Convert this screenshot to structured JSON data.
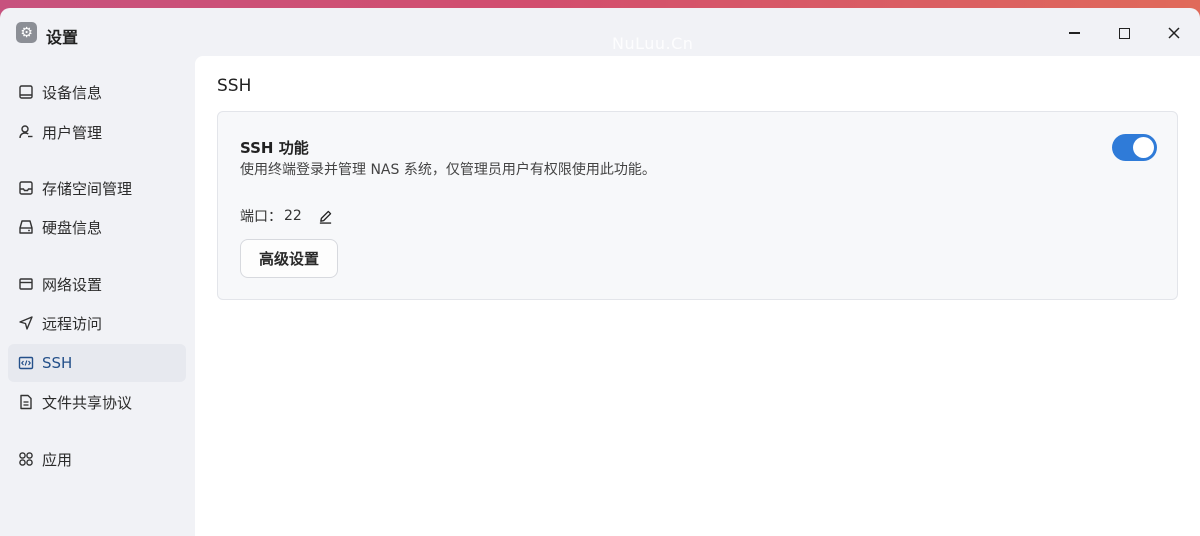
{
  "window": {
    "title": "设置",
    "icon": "gear-icon",
    "watermark": "NuLuu.Cn",
    "controls": [
      "minimize-icon",
      "maximize-icon",
      "close-icon"
    ]
  },
  "sidebar": {
    "items": [
      {
        "label": "设备信息",
        "icon": "device-icon",
        "active": false
      },
      {
        "label": "用户管理",
        "icon": "user-icon",
        "active": false
      },
      {
        "label": "存储空间管理",
        "icon": "storage-icon",
        "active": false
      },
      {
        "label": "硬盘信息",
        "icon": "disk-icon",
        "active": false
      },
      {
        "label": "网络设置",
        "icon": "network-icon",
        "active": false
      },
      {
        "label": "远程访问",
        "icon": "send-icon",
        "active": false
      },
      {
        "label": "SSH",
        "icon": "code-icon",
        "active": true
      },
      {
        "label": "文件共享协议",
        "icon": "document-icon",
        "active": false
      },
      {
        "label": "应用",
        "icon": "apps-icon",
        "active": false
      }
    ]
  },
  "main": {
    "title": "SSH",
    "card": {
      "title": "SSH 功能",
      "description": "使用终端登录并管理 NAS 系统，仅管理员用户有权限使用此功能。",
      "toggle_on": true,
      "port_label": "端口：",
      "port_value": "22",
      "advanced_button": "高级设置"
    }
  },
  "colors": {
    "accent": "#2f7bd8",
    "active_text": "#24508a",
    "sidebar_bg": "#f1f2f6",
    "panel_bg": "#ffffff"
  }
}
